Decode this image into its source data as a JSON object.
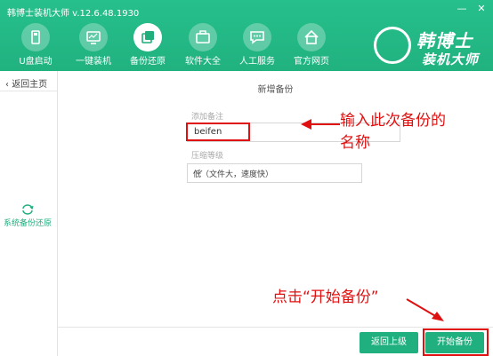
{
  "app": {
    "title": "韩博士装机大师 v.12.6.48.1930"
  },
  "window_controls": {
    "minimize": "—",
    "close": "✕"
  },
  "nav": [
    {
      "label": "U盘启动",
      "icon": "usb-icon"
    },
    {
      "label": "一键装机",
      "icon": "monitor-icon"
    },
    {
      "label": "备份还原",
      "icon": "backup-icon",
      "active": true
    },
    {
      "label": "软件大全",
      "icon": "briefcase-icon"
    },
    {
      "label": "人工服务",
      "icon": "chat-icon"
    },
    {
      "label": "官方网页",
      "icon": "home-icon"
    }
  ],
  "logo": {
    "line1": "韩博士",
    "line2": "装机大师"
  },
  "sidebar": {
    "back_label": "返回主页",
    "item_label": "系统备份还原"
  },
  "form": {
    "title": "新增备份",
    "note_label": "添加备注",
    "note_value": "beifen",
    "compression_label": "压缩等级",
    "compression_value": "低（文件大，速度快）"
  },
  "annotations": {
    "line1": "输入此次备份的",
    "line2": "名称",
    "click_hint": "点击“开始备份”"
  },
  "buttons": {
    "back": "返回上级",
    "start": "开始备份"
  },
  "colors": {
    "accent": "#1fae7c",
    "annotation": "#e01010"
  }
}
